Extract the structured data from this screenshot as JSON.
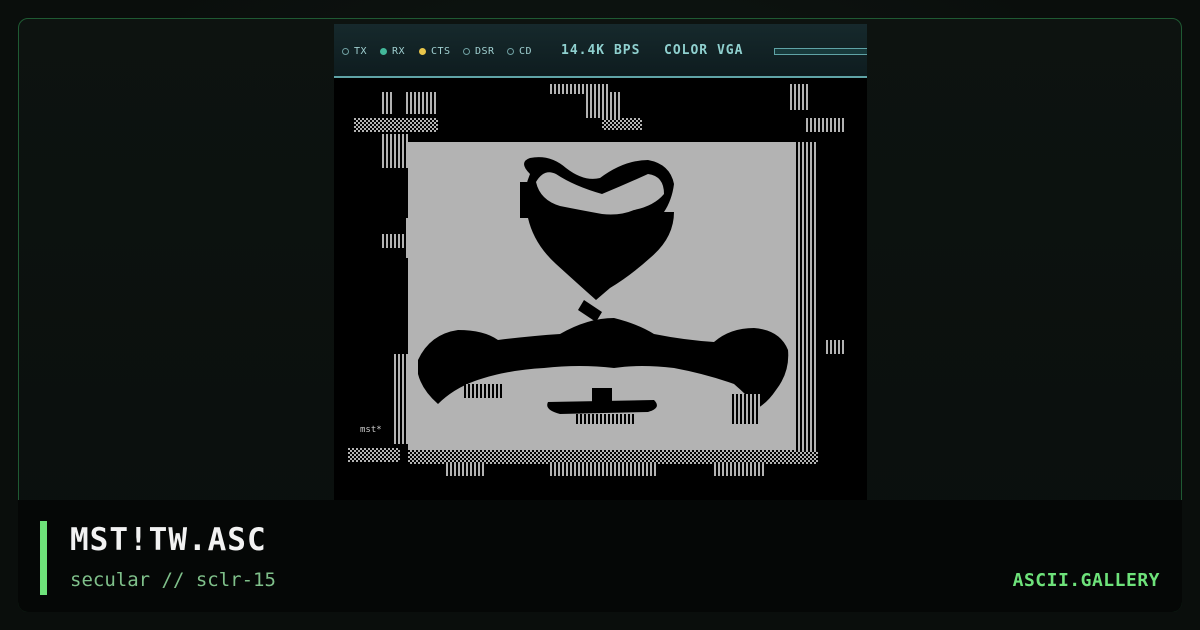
{
  "terminal": {
    "indicators": [
      {
        "label": "TX",
        "state": "off"
      },
      {
        "label": "RX",
        "state": "on",
        "color": "#43b89a"
      },
      {
        "label": "CTS",
        "state": "on",
        "color": "#e8c54a"
      },
      {
        "label": "DSR",
        "state": "off"
      },
      {
        "label": "CD",
        "state": "off"
      }
    ],
    "baud": "14.4K BPS",
    "mode": "COLOR VGA"
  },
  "artwork": {
    "signature": "mst*",
    "colors": {
      "background": "#000000",
      "foreground": "#b3b3b3",
      "ink": "#000000"
    }
  },
  "footer": {
    "title": "MST!TW.ASC",
    "subtitle": "secular // sclr-15",
    "brand": "ASCII.GALLERY",
    "accent_color": "#6ee27a"
  }
}
